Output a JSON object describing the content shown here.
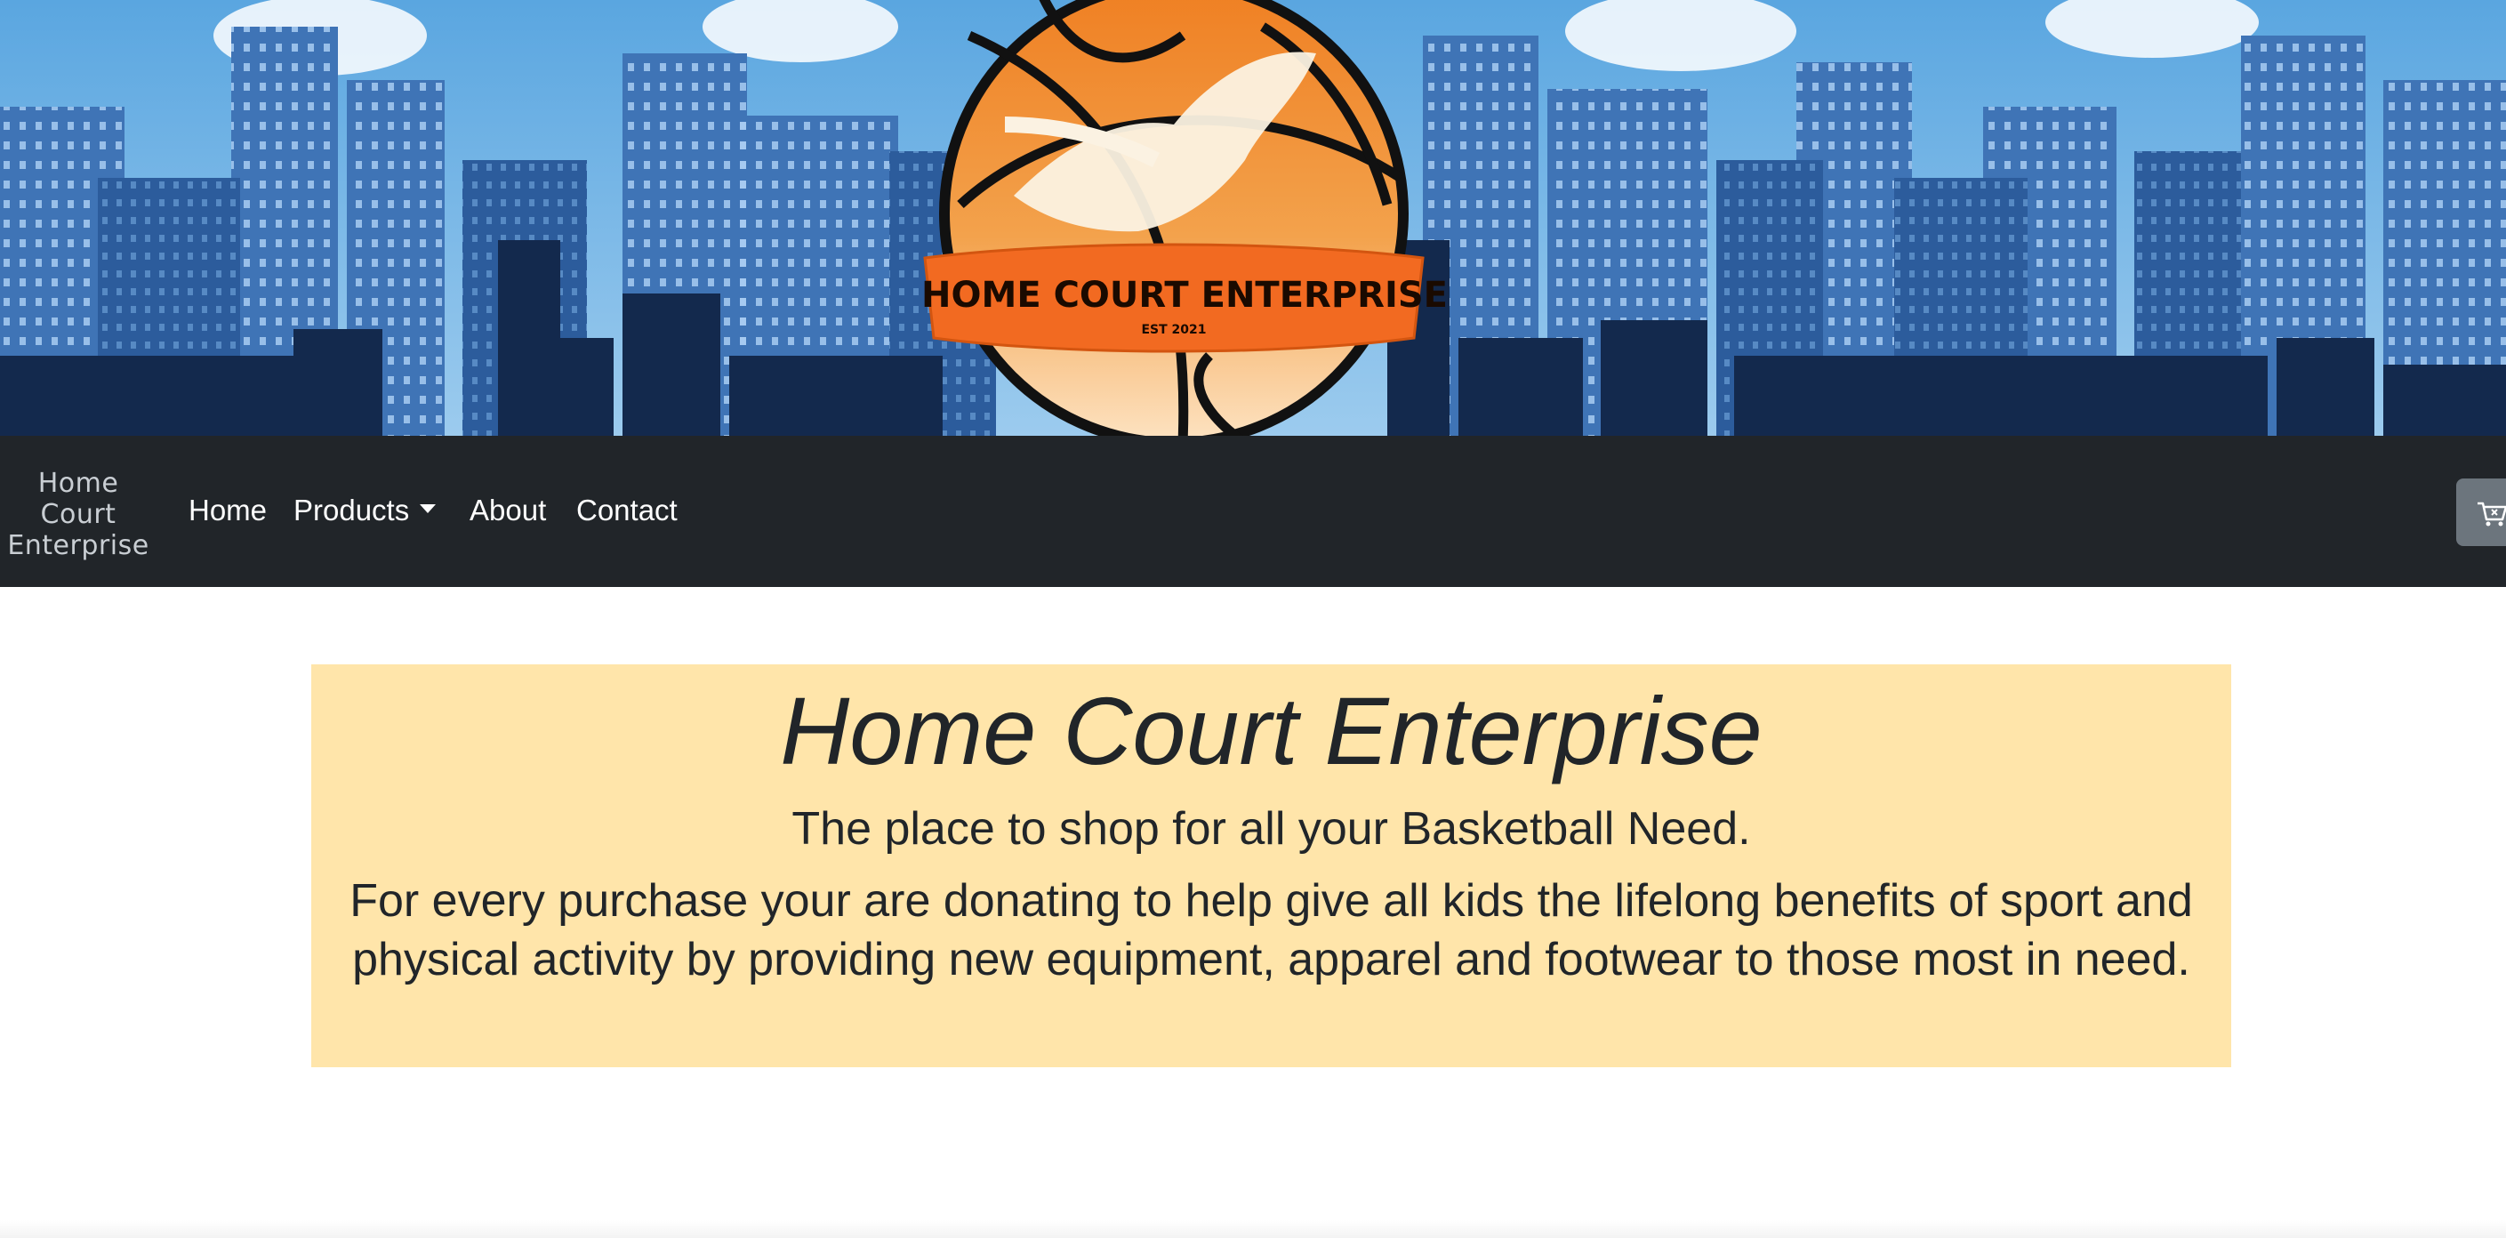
{
  "banner": {
    "logo_text": "HOME COURT ENTERPRISE",
    "logo_subtext": "EST 2021",
    "colors": {
      "sky": "#6fb0e6",
      "building_dark": "#1e3f72",
      "ball_orange": "#f0862d",
      "ribbon": "#f26a21"
    }
  },
  "navbar": {
    "brand_line1": "Home",
    "brand_line2": "Court",
    "brand_line3": "Enterprise",
    "home_label": "Home",
    "products_label": "Products",
    "about_label": "About",
    "contact_label": "Contact",
    "cart_icon": "cart-icon",
    "background": "#212529"
  },
  "hero": {
    "title": "Home Court Enterprise",
    "subtitle": "The place to shop for all your Basketball Need.",
    "body": "For every purchase your are donating to help give all kids the lifelong benefits of sport and physical activity by providing new equipment, apparel and footwear to those most in need.",
    "background": "#ffe5aa"
  }
}
